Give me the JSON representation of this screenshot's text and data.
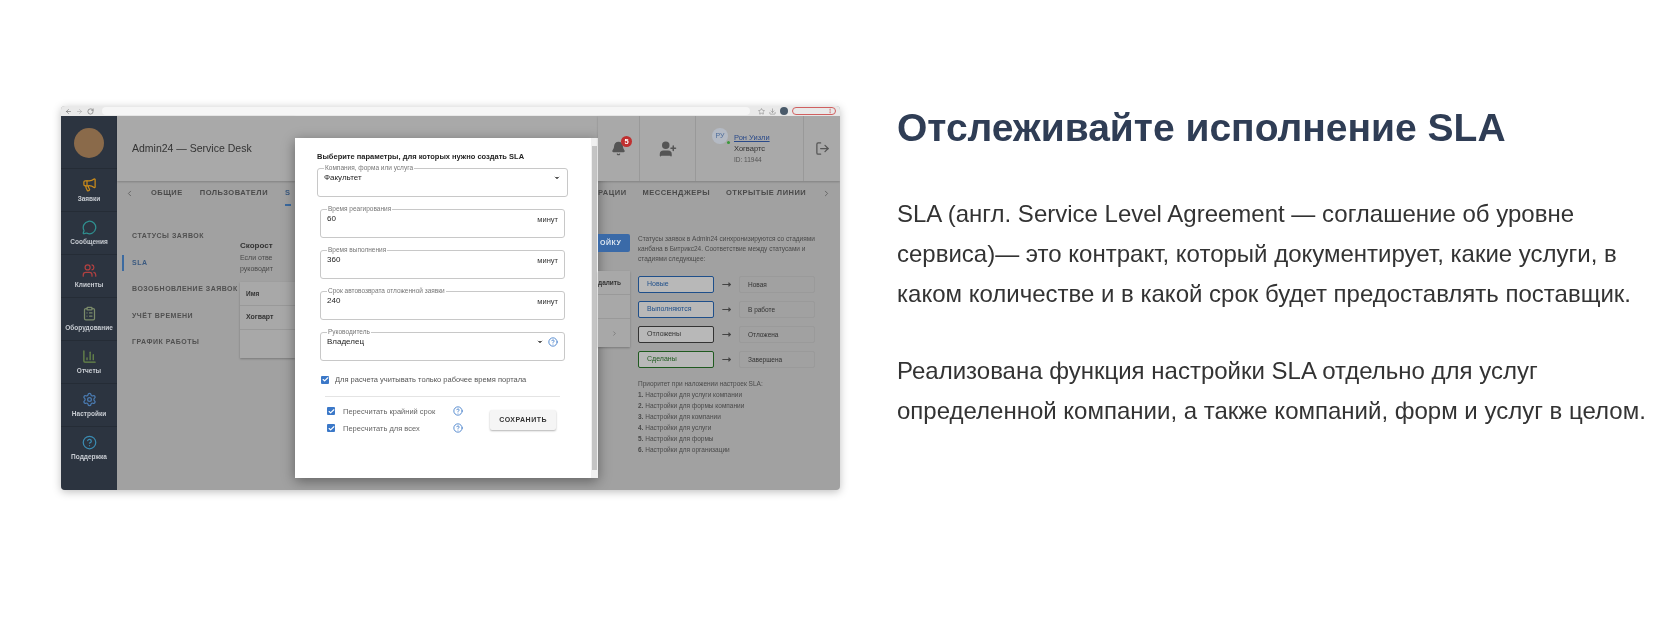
{
  "sidebar": {
    "items": [
      {
        "label": "Заявки",
        "kind": "requests"
      },
      {
        "label": "Сообщения",
        "kind": "messages"
      },
      {
        "label": "Клиенты",
        "kind": "clients"
      },
      {
        "label": "Оборудование",
        "kind": "equipment"
      },
      {
        "label": "Отчеты",
        "kind": "reports"
      },
      {
        "label": "Настройки",
        "kind": "settings"
      },
      {
        "label": "Поддержка",
        "kind": "support"
      }
    ]
  },
  "header": {
    "title": "Admin24 — Service Desk",
    "notifications": "5",
    "user": {
      "initials": "РУ",
      "online": true,
      "name": "Рон Уизли",
      "org": "Хогвартс",
      "id": "ID: 11944"
    }
  },
  "tabs_left": [
    {
      "label": "ОБЩИЕ",
      "selected": false
    },
    {
      "label": "ПОЛЬЗОВАТЕЛИ",
      "selected": false
    },
    {
      "label": "S",
      "selected": true
    }
  ],
  "tabs_right": [
    {
      "label": "РАЦИИ",
      "selected": false
    },
    {
      "label": "МЕССЕНДЖЕРЫ",
      "selected": false
    },
    {
      "label": "ОТКРЫТЫЕ ЛИНИИ",
      "selected": false
    }
  ],
  "settings_nav": [
    {
      "label": "СТАТУСЫ ЗАЯВОК",
      "selected": false
    },
    {
      "label": "SLA",
      "selected": true
    },
    {
      "label": "ВОЗОБНОВЛЕНИЕ ЗАЯВОК",
      "selected": false
    },
    {
      "label": "УЧЁТ ВРЕМЕНИ",
      "selected": false
    },
    {
      "label": "ГРАФИК РАБОТЫ",
      "selected": false
    }
  ],
  "section": {
    "heading": "Скорост",
    "lines": [
      "Если отве",
      "руководит"
    ],
    "table_header": "Имя",
    "table_row": "Хогварт",
    "button": "ОЙКУ",
    "column_3": "далить"
  },
  "statuses": {
    "intro": "Статусы заявок в Admin24 синхронизируются со стадиями канбана в Битрикс24. Соответствие между статусами и стадиями следующее:",
    "rows": [
      {
        "status": "Новые",
        "stage": "Новая",
        "color": "#1f4f8a"
      },
      {
        "status": "Выполняются",
        "stage": "В работе",
        "color": "#1f4f8a"
      },
      {
        "status": "Отложены",
        "stage": "Отложена",
        "color": "#333333"
      },
      {
        "status": "Сделаны",
        "stage": "Завершена",
        "color": "#1f5a1f"
      }
    ],
    "priority_title": "Приоритет при наложении настроек SLA:",
    "priority": [
      {
        "num": "1.",
        "text": "Настройки для услуги компании"
      },
      {
        "num": "2.",
        "text": "Настройки для формы компании"
      },
      {
        "num": "3.",
        "text": "Настройки для компании"
      },
      {
        "num": "4.",
        "text": "Настройки для услуги"
      },
      {
        "num": "5.",
        "text": "Настройки для формы"
      },
      {
        "num": "6.",
        "text": "Настройки для организации"
      }
    ]
  },
  "modal": {
    "title": "Выберите параметры, для которых нужно создать SLA",
    "fields": [
      {
        "kind": "select",
        "label": "Компания, форма или услуга",
        "value": "Факультет",
        "help": false
      },
      {
        "kind": "number",
        "label": "Время реагирования",
        "value": "60",
        "unit": "минут"
      },
      {
        "kind": "number",
        "label": "Время выполнения",
        "value": "360",
        "unit": "минут"
      },
      {
        "kind": "number",
        "label": "Срок автовозврата отложенной заявки",
        "value": "240",
        "unit": "минут"
      },
      {
        "kind": "select",
        "label": "Руководитель",
        "value": "Владелец",
        "help": true
      }
    ],
    "option": {
      "label": "Для расчета учитывать только рабочее время портала",
      "checked": true
    },
    "recalc": [
      {
        "label": "Пересчитать крайний срок",
        "checked": true,
        "help": true
      },
      {
        "label": "Пересчитать для всех",
        "checked": true,
        "help": true
      }
    ],
    "save": "СОХРАНИТЬ"
  },
  "article": {
    "heading": "Отслеживайте исполнение SLA",
    "paragraphs": [
      "SLA (англ. Service Level Agreement — соглашение об уровне сервиса)— это контракт, который документирует, какие услуги, в каком количестве и в какой срок будет предоставлять поставщик.",
      "Реализована функция настройки SLA отдельно для услуг определенной компании, а также компаний, форм и услуг в целом."
    ]
  }
}
